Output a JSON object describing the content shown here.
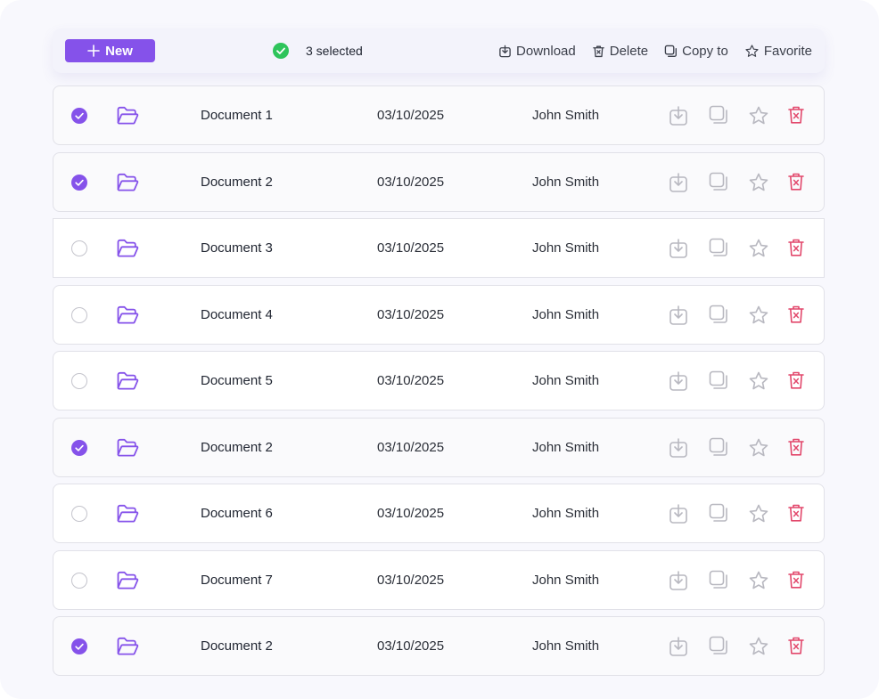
{
  "toolbar": {
    "new_label": "New",
    "selected_text": "3 selected",
    "actions": {
      "download": "Download",
      "delete": "Delete",
      "copy": "Copy to",
      "favorite": "Favorite"
    }
  },
  "colors": {
    "accent": "#8552ea",
    "success": "#2ec45b",
    "danger": "#e2476b",
    "muted_icon": "#b8b8c0"
  },
  "files": [
    {
      "name": "Document 1",
      "date": "03/10/2025",
      "owner": "John Smith",
      "selected": true
    },
    {
      "name": "Document 2",
      "date": "03/10/2025",
      "owner": "John Smith",
      "selected": true
    },
    {
      "name": "Document 3",
      "date": "03/10/2025",
      "owner": "John Smith",
      "selected": false
    },
    {
      "name": "Document 4",
      "date": "03/10/2025",
      "owner": "John Smith",
      "selected": false
    },
    {
      "name": "Document 5",
      "date": "03/10/2025",
      "owner": "John Smith",
      "selected": false
    },
    {
      "name": "Document 2",
      "date": "03/10/2025",
      "owner": "John Smith",
      "selected": true
    },
    {
      "name": "Document 6",
      "date": "03/10/2025",
      "owner": "John Smith",
      "selected": false
    },
    {
      "name": "Document 7",
      "date": "03/10/2025",
      "owner": "John Smith",
      "selected": false
    },
    {
      "name": "Document 2",
      "date": "03/10/2025",
      "owner": "John Smith",
      "selected": true
    }
  ]
}
